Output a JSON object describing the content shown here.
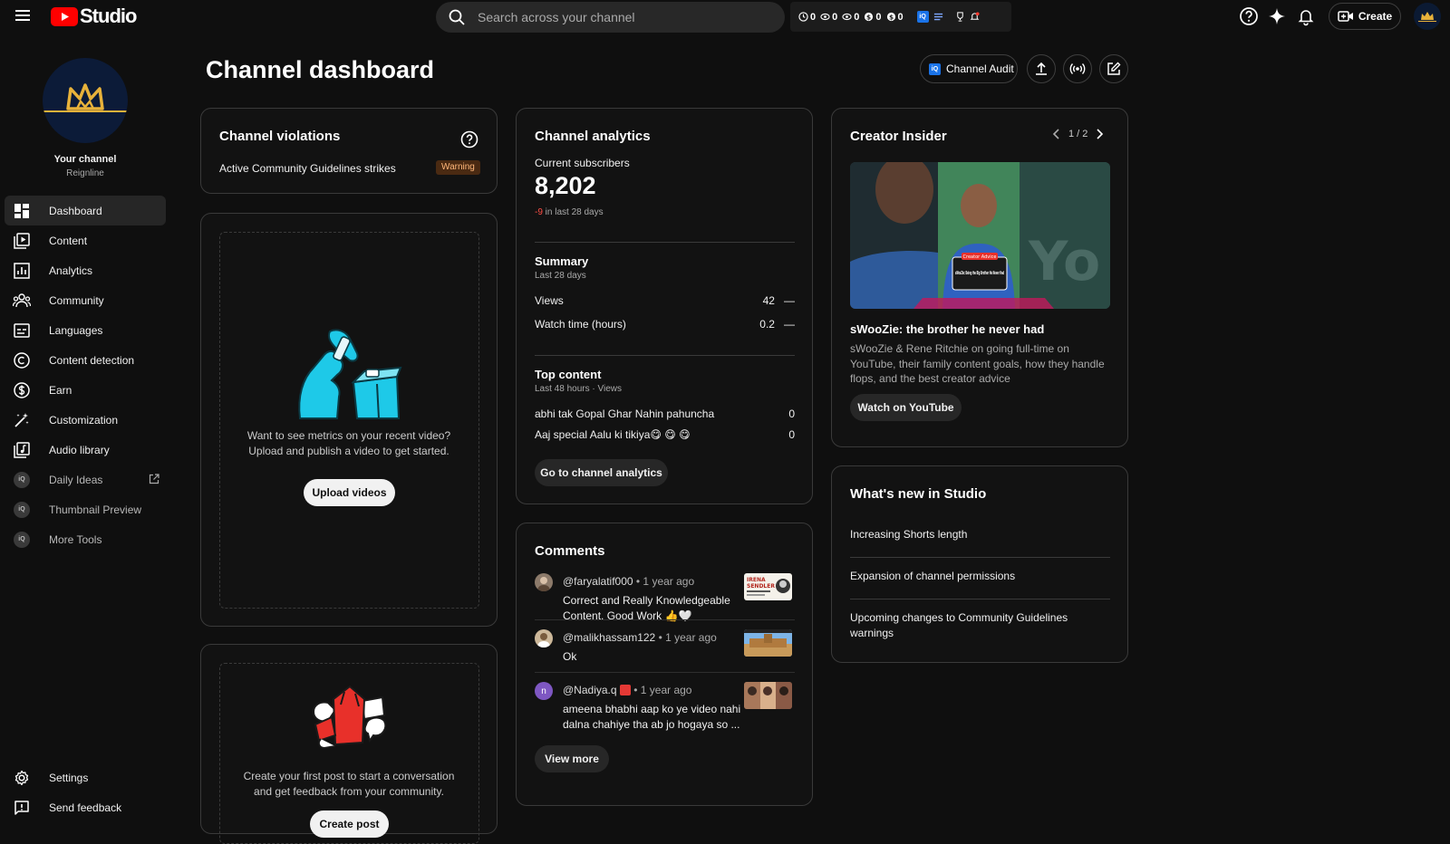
{
  "app": {
    "logo_text": "Studio"
  },
  "search": {
    "placeholder": "Search across your channel"
  },
  "ext_bar": {
    "counts": [
      "0",
      "0",
      "0",
      "0",
      "0"
    ]
  },
  "topbar": {
    "create_label": "Create"
  },
  "sidebar": {
    "your_channel": "Your channel",
    "channel_name": "Reignline",
    "items": [
      {
        "label": "Dashboard",
        "icon": "dashboard-icon"
      },
      {
        "label": "Content",
        "icon": "content-icon"
      },
      {
        "label": "Analytics",
        "icon": "analytics-icon"
      },
      {
        "label": "Community",
        "icon": "community-icon"
      },
      {
        "label": "Languages",
        "icon": "subtitles-icon"
      },
      {
        "label": "Content detection",
        "icon": "copyright-icon"
      },
      {
        "label": "Earn",
        "icon": "dollar-icon"
      },
      {
        "label": "Customization",
        "icon": "magic-wand-icon"
      },
      {
        "label": "Audio library",
        "icon": "audio-library-icon"
      },
      {
        "label": "Daily Ideas",
        "icon": "iq-icon"
      },
      {
        "label": "Thumbnail Preview",
        "icon": "iq-icon"
      },
      {
        "label": "More Tools",
        "icon": "iq-icon"
      }
    ],
    "bottom": [
      {
        "label": "Settings",
        "icon": "gear-icon"
      },
      {
        "label": "Send feedback",
        "icon": "feedback-icon"
      }
    ]
  },
  "main": {
    "title": "Channel dashboard",
    "audit_label": "Channel Audit",
    "iq": "iQ"
  },
  "violations": {
    "title": "Channel violations",
    "label": "Active Community Guidelines strikes",
    "badge": "Warning"
  },
  "upload": {
    "line1": "Want to see metrics on your recent video?",
    "line2": "Upload and publish a video to get started.",
    "button": "Upload videos"
  },
  "post": {
    "line1": "Create your first post to start a conversation",
    "line2": "and get feedback from your community.",
    "button": "Create post"
  },
  "analytics": {
    "title": "Channel analytics",
    "subs_label": "Current subscribers",
    "subs_value": "8,202",
    "subs_change": "-9",
    "subs_change_suffix": " in last 28 days",
    "summary_title": "Summary",
    "summary_period": "Last 28 days",
    "metrics": [
      {
        "label": "Views",
        "value": "42",
        "trend": "—"
      },
      {
        "label": "Watch time (hours)",
        "value": "0.2",
        "trend": "—"
      }
    ],
    "top_title": "Top content",
    "top_period": "Last 48 hours · Views",
    "top_items": [
      {
        "title": "abhi tak Gopal Ghar Nahin pahuncha",
        "views": "0"
      },
      {
        "title": "Aaj special Aalu ki tikiya😋 😋 😋",
        "views": "0"
      }
    ],
    "button": "Go to channel analytics"
  },
  "comments": {
    "title": "Comments",
    "items": [
      {
        "author": "@faryalatif000",
        "time": " • 1 year ago",
        "text": "Correct and Really Knowledgeable Content. Good Work 👍🤍"
      },
      {
        "author": "@malikhassam122",
        "time": " • 1 year ago",
        "text": "Ok"
      },
      {
        "author": "@Nadiya.q",
        "time": " • 1 year ago",
        "text": "ameena bhabhi aap ko ye video nahi dalna chahiye tha ab jo hogaya so ..."
      }
    ],
    "thumb_text": [
      "IRENA",
      "SENDLER"
    ],
    "avatar_letter": "n",
    "button": "View more"
  },
  "insider": {
    "title": "Creator Insider",
    "pager": "1 / 2",
    "video_title": "sWooZie: the brother he never had",
    "desc": "sWooZie & Rene Ritchie on going full-time on YouTube, their family content goals, how they handle flops, and the best creator advice",
    "button": "Watch on YouTube",
    "thumb_badge": "Creator Advice",
    "thumb_caption": "sWooZie: Being the Big Brother He Never Had"
  },
  "whatsnew": {
    "title": "What's new in Studio",
    "items": [
      "Increasing Shorts length",
      "Expansion of channel permissions",
      "Upcoming changes to Community Guidelines warnings"
    ]
  },
  "colors": {
    "accent_red": "#ff0000",
    "negative": "#ff4e45",
    "warning_bg": "#4a2a12",
    "brand_gold": "#e8b23a"
  }
}
